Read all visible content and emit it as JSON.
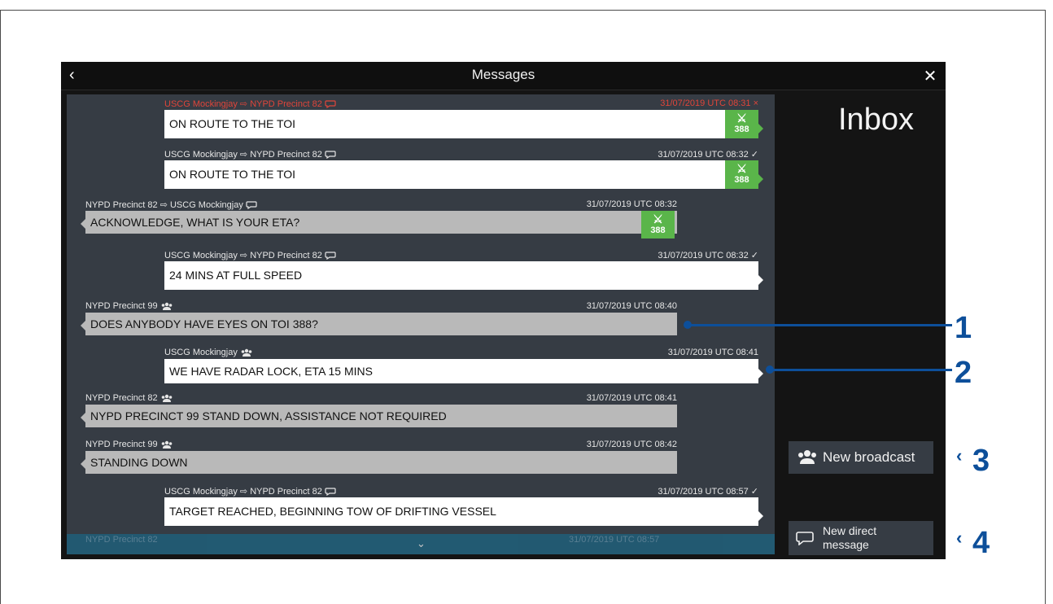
{
  "window": {
    "title": "Messages"
  },
  "inbox_label": "Inbox",
  "messages": [
    {
      "from_to": "USCG Mockingjay ⇨ NYPD Precinct 82",
      "time": "31/07/2019  UTC 08:31 ×",
      "text": "ON ROUTE TO THE TOI",
      "badge": "388",
      "status": "failed"
    },
    {
      "from_to": "USCG Mockingjay ⇨ NYPD Precinct 82",
      "time": "31/07/2019  UTC 08:32 ✓",
      "text": "ON ROUTE TO THE TOI",
      "badge": "388"
    },
    {
      "from_to": "NYPD Precinct 82 ⇨ USCG Mockingjay",
      "time": "31/07/2019  UTC 08:32",
      "text": "ACKNOWLEDGE, WHAT IS YOUR ETA?",
      "badge": "388"
    },
    {
      "from_to": "USCG Mockingjay ⇨ NYPD Precinct 82",
      "time": "31/07/2019  UTC 08:32 ✓",
      "text": "24 MINS AT FULL SPEED"
    },
    {
      "from_to": "NYPD Precinct 99",
      "time": "31/07/2019  UTC 08:40",
      "text": "DOES ANYBODY HAVE EYES ON TOI 388?"
    },
    {
      "from_to": "USCG Mockingjay",
      "time": "31/07/2019  UTC 08:41",
      "text": "WE HAVE RADAR LOCK, ETA 15 MINS"
    },
    {
      "from_to": "NYPD Precinct 82",
      "time": "31/07/2019  UTC 08:41",
      "text": "NYPD PRECINCT 99 STAND DOWN, ASSISTANCE NOT REQUIRED"
    },
    {
      "from_to": "NYPD Precinct 99",
      "time": "31/07/2019  UTC 08:42",
      "text": "STANDING DOWN"
    },
    {
      "from_to": "USCG Mockingjay ⇨ NYPD Precinct 82",
      "time": "31/07/2019  UTC 08:57 ✓",
      "text": "TARGET REACHED, BEGINNING TOW OF DRIFTING VESSEL"
    },
    {
      "from_to": "NYPD Precinct 82",
      "time": "31/07/2019  UTC 08:57",
      "text": ""
    }
  ],
  "buttons": {
    "new_broadcast": "New broadcast",
    "new_direct_line1": "New direct",
    "new_direct_line2": "message"
  },
  "callouts": [
    "1",
    "2",
    "3",
    "4"
  ],
  "colors": {
    "link_badge": "#5ab54a",
    "callout": "#0d4f9a",
    "failed": "#e0453a"
  }
}
